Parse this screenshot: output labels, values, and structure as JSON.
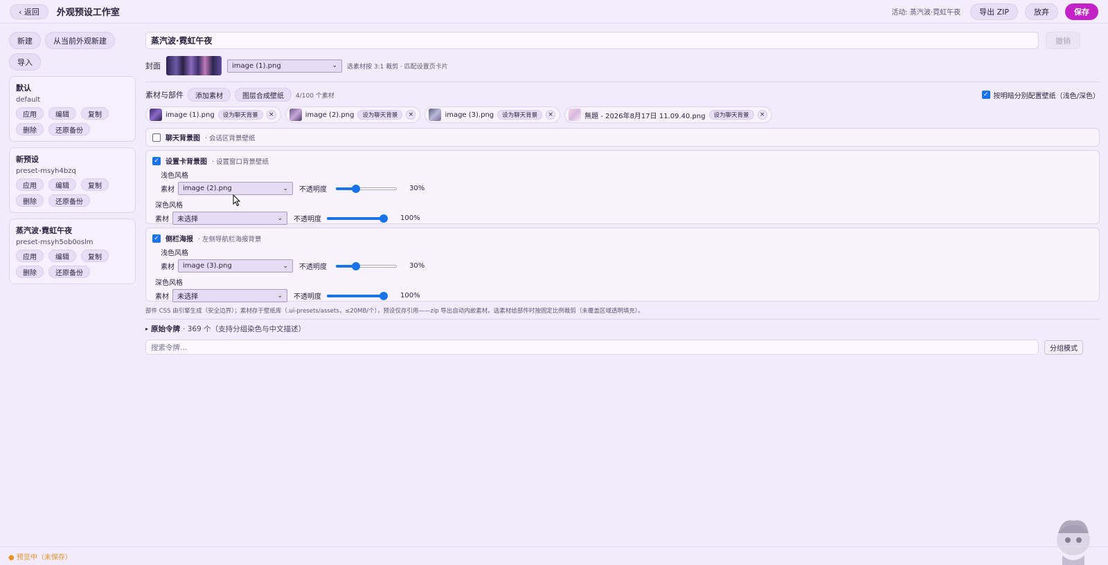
{
  "topbar": {
    "back_label": "‹ 返回",
    "title": "外观预设工作室",
    "active_text": "活动: 蒸汽波·霓虹午夜",
    "export_label": "导出 ZIP",
    "discard_label": "放弃",
    "save_label": "保存"
  },
  "sidebar": {
    "new_label": "新建",
    "new_from_current_label": "从当前外观新建",
    "import_label": "导入",
    "presets": [
      {
        "name": "默认",
        "id": "default",
        "apply": "应用",
        "edit": "编辑",
        "copy": "复制",
        "delete": "删除",
        "restore": "还原备份"
      },
      {
        "name": "新预设",
        "id": "preset-msyh4bzq",
        "apply": "应用",
        "edit": "编辑",
        "copy": "复制",
        "delete": "删除",
        "restore": "还原备份"
      },
      {
        "name": "蒸汽波·霓虹午夜",
        "id": "preset-msyh5ob0oslm",
        "apply": "应用",
        "edit": "编辑",
        "copy": "复制",
        "delete": "删除",
        "restore": "还原备份"
      }
    ]
  },
  "editor": {
    "preset_name_value": "蒸汽波·霓虹午夜",
    "undo_label": "撤销",
    "cover": {
      "label": "封面",
      "selected": "image (1).png",
      "hint": "选素材按 3:1 裁剪 · 匹配设置页卡片"
    },
    "assets": {
      "label": "素材与部件",
      "add_label": "添加素材",
      "compose_label": "图层合成壁纸",
      "count_text": "4/100 个素材",
      "light_dark_label": "按明暗分别配置壁纸（浅色/深色）",
      "light_dark_checked": true,
      "items": [
        {
          "name": "image (1).png",
          "set_bg_label": "设为聊天背景",
          "close": "×"
        },
        {
          "name": "image (2).png",
          "set_bg_label": "设为聊天背景",
          "close": "×"
        },
        {
          "name": "image (3).png",
          "set_bg_label": "设为聊天背景",
          "close": "×"
        },
        {
          "name": "無題 - 2026年8月17日 11.09.40.png",
          "set_bg_label": "设为聊天背景",
          "close": "×"
        }
      ]
    },
    "chat_bg": {
      "checked": false,
      "title": "聊天背景图",
      "subtitle": "· 会话区背景壁纸"
    },
    "settings_bg": {
      "checked": true,
      "title": "设置卡背景图",
      "subtitle": "· 设置窗口背景壁纸",
      "light": {
        "style_label": "浅色风格",
        "asset_label": "素材",
        "selected": "image (2).png",
        "opacity_label": "不透明度",
        "opacity": 30,
        "opacity_text": "30%"
      },
      "dark": {
        "style_label": "深色风格",
        "asset_label": "素材",
        "selected": "未选择",
        "opacity_label": "不透明度",
        "opacity": 100,
        "opacity_text": "100%"
      }
    },
    "sidebar_poster": {
      "checked": true,
      "title": "侧栏海报",
      "subtitle": "· 左侧导航栏海报背景",
      "light": {
        "style_label": "浅色风格",
        "asset_label": "素材",
        "selected": "image (3).png",
        "opacity_label": "不透明度",
        "opacity": 30,
        "opacity_text": "30%"
      },
      "dark": {
        "style_label": "深色风格",
        "asset_label": "素材",
        "selected": "未选择",
        "opacity_label": "不透明度",
        "opacity": 100,
        "opacity_text": "100%"
      }
    },
    "footer_note": "部件 CSS 由引擎生成（安全边界）；素材存于壁纸库（.ui-presets/assets，≤20MB/个），预设仅存引用——zip 导出自动内嵌素材。选素材给部件时按固定比例裁剪（未覆盖区域透明填充）。",
    "tokens": {
      "arrow": "▸",
      "title": "原始令牌",
      "summary": "· 369 个（支持分组染色与中文描述）"
    },
    "search_placeholder": "搜索令牌…",
    "group_mode_label": "分组模式"
  },
  "status": {
    "text": "● 预览中（未保存）",
    "color": "#e8932a"
  },
  "colors": {
    "accent": "#c322c9",
    "background": "#f1ebfb",
    "slider": "#1a73e8"
  },
  "icons": {
    "checkbox_checked": "check-icon",
    "dropdown": "chevron-down-icon",
    "remove": "close-icon",
    "cursor": "mouse-cursor-icon",
    "mascot": "mascot-icon"
  }
}
